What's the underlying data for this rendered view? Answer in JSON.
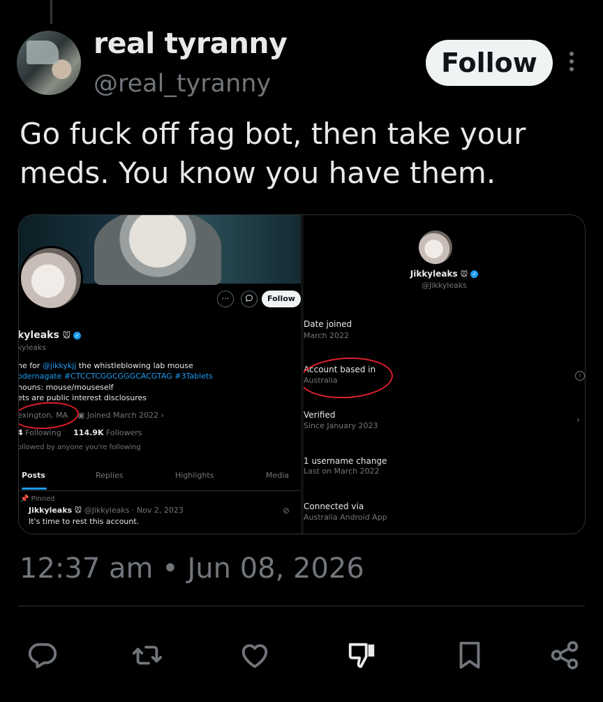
{
  "tweet": {
    "display_name": "real tyranny",
    "handle": "@real_tyranny",
    "follow_label": "Follow",
    "text": "Go fuck off fag bot, then take your meds. You know you have them.",
    "timestamp": "12:37 am • Jun 08, 2026"
  },
  "embedded_profile": {
    "follow_label": "Follow",
    "more_label": "···",
    "name": "kyleaks",
    "name_emoji": "🐭",
    "handle": "kyleaks",
    "bio_line1_prefix": "ne for ",
    "bio_line1_mention": "@jikkykjj",
    "bio_line1_suffix": " the whistleblowing lab mouse",
    "bio_line2": "odernagate #CTCCTCGGCGGGCACGTAG #3Tablets",
    "bio_line3": "nouns: mouse/mouseself",
    "bio_line4": "ets are public interest disclosures",
    "location": "exington, MA",
    "joined": "Joined March 2022 ›",
    "following_count": "4",
    "following_label": "Following",
    "followers_count": "114.9K",
    "followers_label": "Followers",
    "followed_note": "ollowed by anyone you're following",
    "tabs": [
      "Posts",
      "Replies",
      "Highlights",
      "Media"
    ],
    "pinned_label": "Pinned",
    "pinned_name": "Jikkyleaks",
    "pinned_meta": "@Jikkyleaks · Nov 2, 2023",
    "pinned_text": "It's time to rest this account."
  },
  "about_account": {
    "name": "Jikkyleaks",
    "name_emoji": "🐭",
    "handle": "@Jikkyleaks",
    "rows": [
      {
        "label": "Date joined",
        "value": "March 2022"
      },
      {
        "label": "Account based in",
        "value": "Australia"
      },
      {
        "label": "Verified",
        "value": "Since January 2023"
      },
      {
        "label": "1 username change",
        "value": "Last on March 2022"
      },
      {
        "label": "Connected via",
        "value": "Australia Android App"
      }
    ]
  },
  "actions": {
    "reply": "reply-icon",
    "repost": "repost-icon",
    "like": "like-icon",
    "dislike": "dislike-icon",
    "bookmark": "bookmark-icon",
    "share": "share-icon"
  },
  "colors": {
    "background": "#000000",
    "text": "#e7e9ea",
    "muted": "#71767b",
    "accent": "#1d9bf0",
    "annotation": "#e0202a"
  }
}
